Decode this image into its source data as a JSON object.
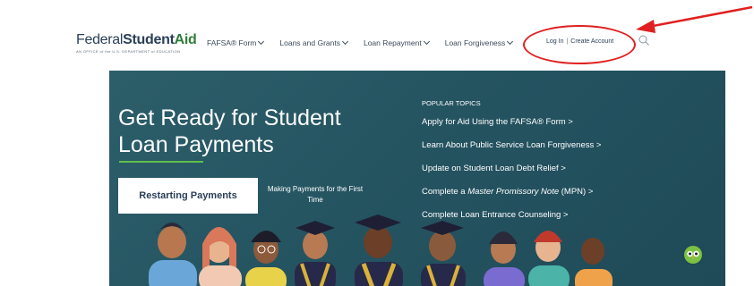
{
  "header": {
    "logo": {
      "part1": "Federal",
      "part2": "Student",
      "part3": "Aid",
      "subtitle": "AN OFFICE of the U.S. DEPARTMENT of EDUCATION"
    },
    "nav": [
      {
        "label": "FAFSA® Form"
      },
      {
        "label": "Loans and Grants"
      },
      {
        "label": "Loan Repayment"
      },
      {
        "label": "Loan Forgiveness"
      }
    ],
    "login_label": "Log In",
    "separator": "|",
    "create_account_label": "Create Account"
  },
  "hero": {
    "title_line1": "Get Ready for Student",
    "title_line2": "Loan Payments",
    "primary_button": "Restarting Payments",
    "secondary_link": "Making Payments for the First Time",
    "popular_title": "POPULAR TOPICS",
    "topics": [
      {
        "label": "Apply for Aid Using the FAFSA® Form >"
      },
      {
        "label": "Learn About Public Service Loan Forgiveness >"
      },
      {
        "label": "Update on Student Loan Debt Relief >"
      },
      {
        "label_prefix": "Complete a ",
        "label_em": "Master Promissory Note",
        "label_suffix": " (MPN) >"
      },
      {
        "label": "Complete Loan Entrance Counseling >"
      }
    ]
  },
  "icons": {
    "search": "search-icon",
    "chat": "owl-chat-icon"
  },
  "colors": {
    "hero_bg": "#255461",
    "accent_green": "#5fbf4a",
    "annotation_red": "#e02020"
  }
}
